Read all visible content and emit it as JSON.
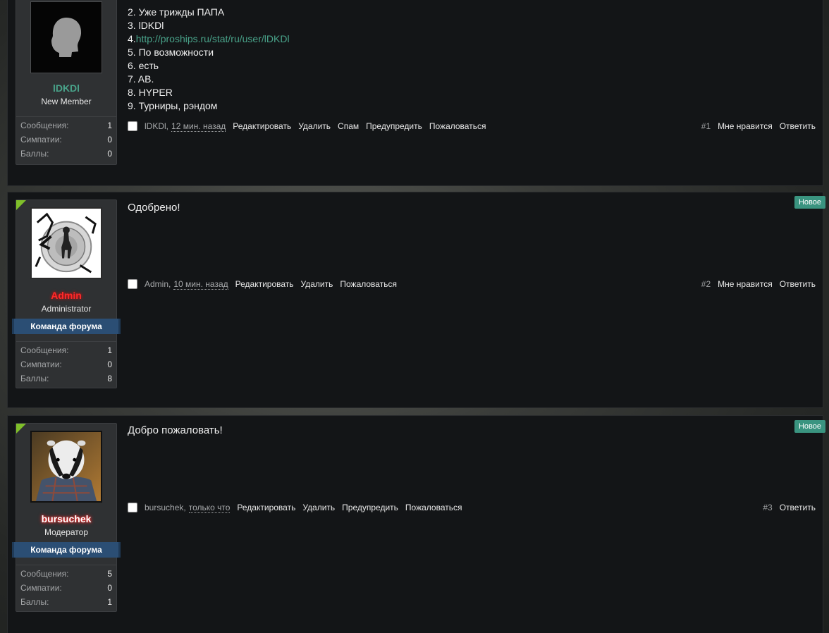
{
  "posts": [
    {
      "user": {
        "name": "lDKDl",
        "title": "New Member",
        "stats": [
          {
            "label": "Сообщения:",
            "value": "1"
          },
          {
            "label": "Симпатии:",
            "value": "0"
          },
          {
            "label": "Баллы:",
            "value": "0"
          }
        ]
      },
      "message_lines": [
        {
          "num": "2.",
          "text": " Уже трижды ПАПА"
        },
        {
          "num": "3.",
          "text": " lDKDl"
        },
        {
          "num": "4.",
          "link": "http://proships.ru/stat/ru/user/lDKDl"
        },
        {
          "num": "5.",
          "text": " По возможности"
        },
        {
          "num": "6.",
          "text": " есть"
        },
        {
          "num": "7.",
          "text": " AB."
        },
        {
          "num": "8.",
          "text": " HYPER"
        },
        {
          "num": "9.",
          "text": " Турниры, рэндом"
        }
      ],
      "meta": {
        "author": "lDKDl,",
        "time": "12 мин. назад"
      },
      "actions": [
        "Редактировать",
        "Удалить",
        "Спам",
        "Предупредить",
        "Пожаловаться"
      ],
      "post_number": "#1",
      "like_label": "Мне нравится",
      "reply_label": "Ответить"
    },
    {
      "user": {
        "name": "Admin",
        "title": "Administrator",
        "team_badge": "Команда форума",
        "stats": [
          {
            "label": "Сообщения:",
            "value": "1"
          },
          {
            "label": "Симпатии:",
            "value": "0"
          },
          {
            "label": "Баллы:",
            "value": "8"
          }
        ]
      },
      "message": "Одобрено!",
      "new_badge": "Новое",
      "meta": {
        "author": "Admin,",
        "time": "10 мин. назад"
      },
      "actions": [
        "Редактировать",
        "Удалить",
        "Пожаловаться"
      ],
      "post_number": "#2",
      "like_label": "Мне нравится",
      "reply_label": "Ответить"
    },
    {
      "user": {
        "name": "bursuchek",
        "title": "Модератор",
        "team_badge": "Команда форума",
        "stats": [
          {
            "label": "Сообщения:",
            "value": "5"
          },
          {
            "label": "Симпатии:",
            "value": "0"
          },
          {
            "label": "Баллы:",
            "value": "1"
          }
        ]
      },
      "message": "Добро пожаловать!",
      "new_badge": "Новое",
      "meta": {
        "author": "bursuchek,",
        "time": "только что"
      },
      "actions": [
        "Редактировать",
        "Удалить",
        "Предупредить",
        "Пожаловаться"
      ],
      "post_number": "#3",
      "reply_label": "Ответить"
    }
  ],
  "colors": {
    "username_member": "#49a38a",
    "username_admin": "#ff2a2a",
    "username_moderator": "#ff6a6a",
    "team_badge_bg": "#2b4e74",
    "new_badge_bg": "#3a9480",
    "link": "#49a38a"
  }
}
